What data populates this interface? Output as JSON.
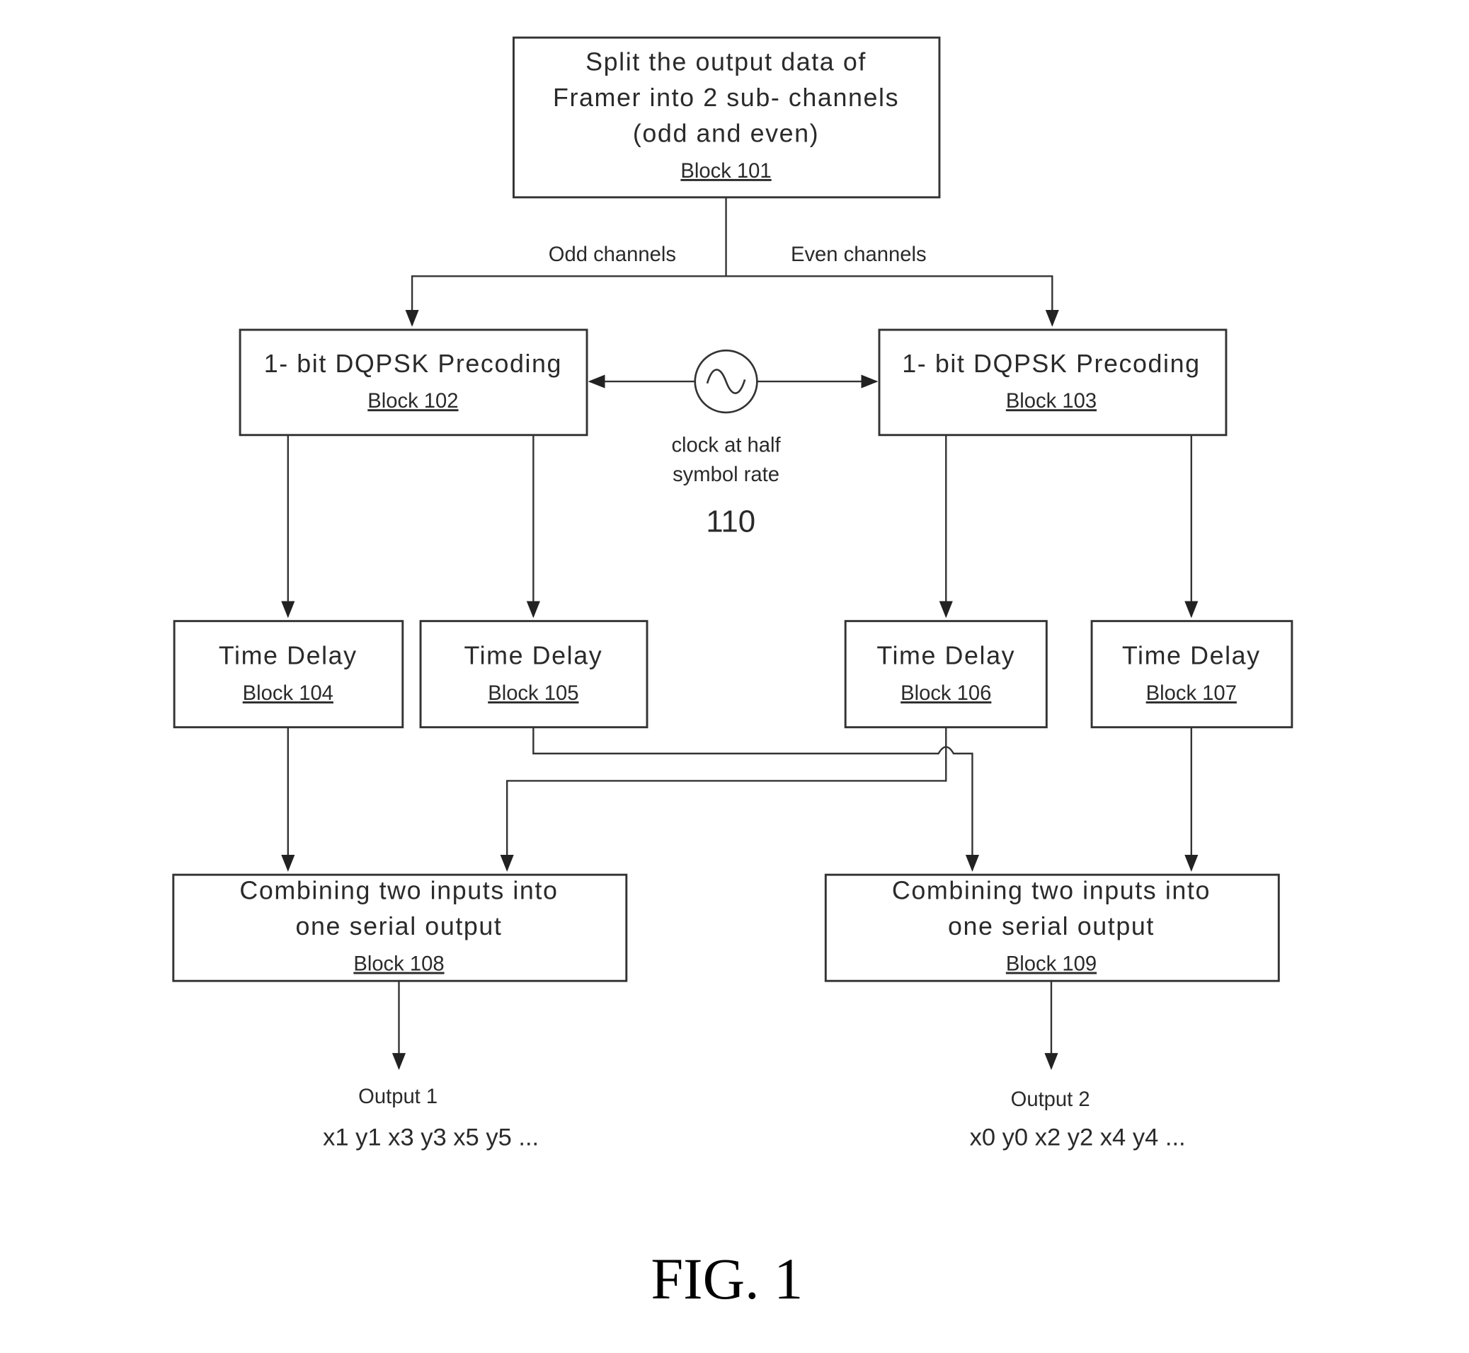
{
  "figure_label": "FIG. 1",
  "blocks": {
    "b101": {
      "lines": [
        "Split the output data of",
        "Framer into 2 sub- channels",
        "(odd and even)"
      ],
      "ref": "Block 101"
    },
    "b102": {
      "lines": [
        "1- bit DQPSK Precoding"
      ],
      "ref": "Block 102"
    },
    "b103": {
      "lines": [
        "1- bit DQPSK Precoding"
      ],
      "ref": "Block 103"
    },
    "b104": {
      "lines": [
        "Time Delay"
      ],
      "ref": "Block 104"
    },
    "b105": {
      "lines": [
        "Time Delay"
      ],
      "ref": "Block 105"
    },
    "b106": {
      "lines": [
        "Time Delay"
      ],
      "ref": "Block 106"
    },
    "b107": {
      "lines": [
        "Time Delay"
      ],
      "ref": "Block 107"
    },
    "b108": {
      "lines": [
        "Combining two inputs into",
        "one serial output"
      ],
      "ref": "Block 108"
    },
    "b109": {
      "lines": [
        "Combining two inputs into",
        "one serial output"
      ],
      "ref": "Block 109"
    }
  },
  "edge_labels": {
    "odd": "Odd channels",
    "even": "Even channels"
  },
  "clock": {
    "icon": "sine-wave-oscillator-icon",
    "label_lines": [
      "clock at half",
      "symbol rate"
    ],
    "ref": "110"
  },
  "outputs": {
    "out1": {
      "title": "Output 1",
      "sequence": "x1 y1 x3 y3 x5 y5  ..."
    },
    "out2": {
      "title": "Output 2",
      "sequence": "x0 y0 x2 y2 x4 y4  ..."
    }
  }
}
